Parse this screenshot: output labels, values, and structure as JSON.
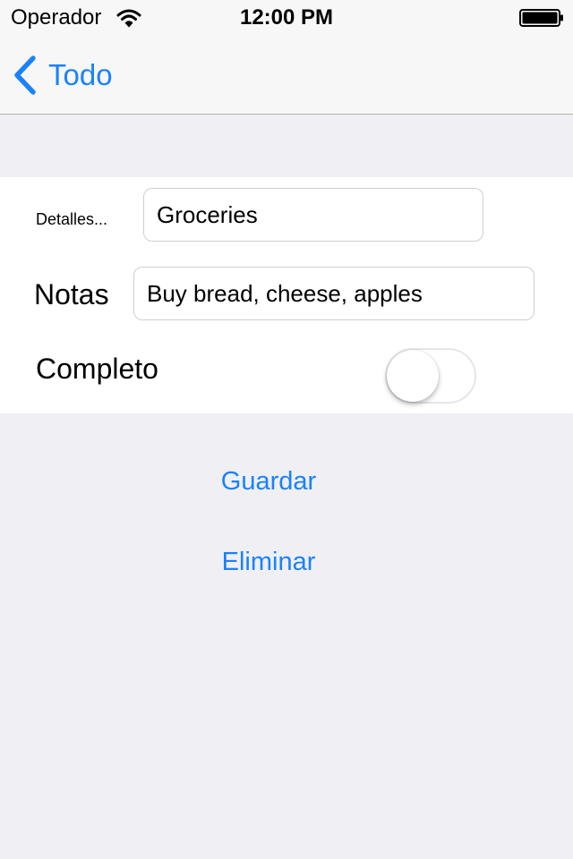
{
  "status_bar": {
    "carrier": "Operador",
    "time": "12:00 PM",
    "icons": [
      "wifi-icon",
      "battery-icon"
    ]
  },
  "nav_bar": {
    "back_label": "Todo",
    "back_icon": "chevron-left-icon",
    "tint_color": "#1a82fb"
  },
  "form": {
    "details_label": "Detalles...",
    "details_value": "Groceries",
    "notes_label": "Notas",
    "notes_value": "Buy bread, cheese, apples",
    "complete_label": "Completo",
    "complete_on": false
  },
  "actions": {
    "save_label": "Guardar",
    "delete_label": "Eliminar"
  }
}
